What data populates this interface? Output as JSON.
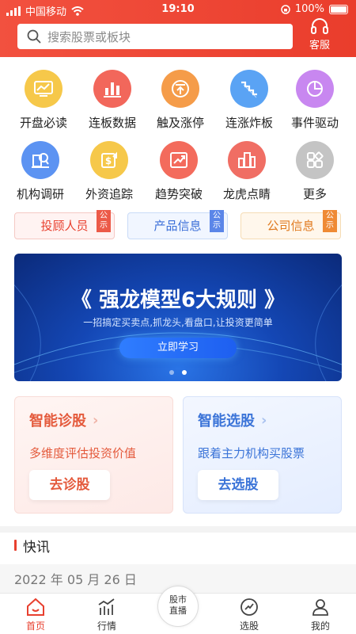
{
  "status": {
    "carrier": "中国移动",
    "time": "19:10",
    "battery": "100%"
  },
  "search": {
    "placeholder": "搜索股票或板块"
  },
  "service": {
    "label": "客服",
    "icon": "headset-icon"
  },
  "grid": [
    {
      "label": "开盘必读",
      "icon": "chart-screen-icon",
      "color": "#f6c84a"
    },
    {
      "label": "连板数据",
      "icon": "bar-chart-icon",
      "color": "#f2675b"
    },
    {
      "label": "触及涨停",
      "icon": "limit-up-icon",
      "color": "#f59c49"
    },
    {
      "label": "连涨炸板",
      "icon": "staircase-icon",
      "color": "#5aa3f4"
    },
    {
      "label": "事件驱动",
      "icon": "pie-icon",
      "color": "#c887f0"
    },
    {
      "label": "机构调研",
      "icon": "research-icon",
      "color": "#5c93f2"
    },
    {
      "label": "外资追踪",
      "icon": "dollar-icon",
      "color": "#f6c84a"
    },
    {
      "label": "趋势突破",
      "icon": "trend-icon",
      "color": "#f36b5c"
    },
    {
      "label": "龙虎点睛",
      "icon": "buildings-icon",
      "color": "#f06e64"
    },
    {
      "label": "更多",
      "icon": "more-grid-icon",
      "color": "#c4c4c4"
    }
  ],
  "tags": [
    {
      "label": "投顾人员",
      "corner": "公示",
      "color": "#e8402f",
      "bg": "#fff3f2",
      "border": "#f5c9c4"
    },
    {
      "label": "产品信息",
      "corner": "公示",
      "color": "#3b6fd8",
      "bg": "#f1f6ff",
      "border": "#c9dbf7"
    },
    {
      "label": "公司信息",
      "corner": "公示",
      "color": "#e07a1f",
      "bg": "#fff7ec",
      "border": "#f5dcb4"
    }
  ],
  "banner": {
    "title": "《 强龙模型6大规则 》",
    "subtitle": "一招搞定买卖点,抓龙头,看盘口,让投资更简单",
    "cta": "立即学习"
  },
  "cards": [
    {
      "title": "智能诊股",
      "desc": "多维度评估投资价值",
      "button": "去诊股",
      "color": "#e45a3c",
      "bg": "#fff2f0"
    },
    {
      "title": "智能选股",
      "desc": "跟着主力机构买股票",
      "button": "去选股",
      "color": "#3b74d8",
      "bg": "#eef4ff"
    }
  ],
  "news": {
    "title": "快讯",
    "date": "2022 年 05 月 26 日"
  },
  "tabs": [
    {
      "label": "首页",
      "icon": "home-icon"
    },
    {
      "label": "行情",
      "icon": "market-icon"
    },
    {
      "label": "股市直播",
      "icon": "live-icon"
    },
    {
      "label": "选股",
      "icon": "stock-pick-icon"
    },
    {
      "label": "我的",
      "icon": "user-icon"
    }
  ],
  "colors": {
    "brand": "#ea3d2c",
    "active_tab": "#e8402f"
  }
}
